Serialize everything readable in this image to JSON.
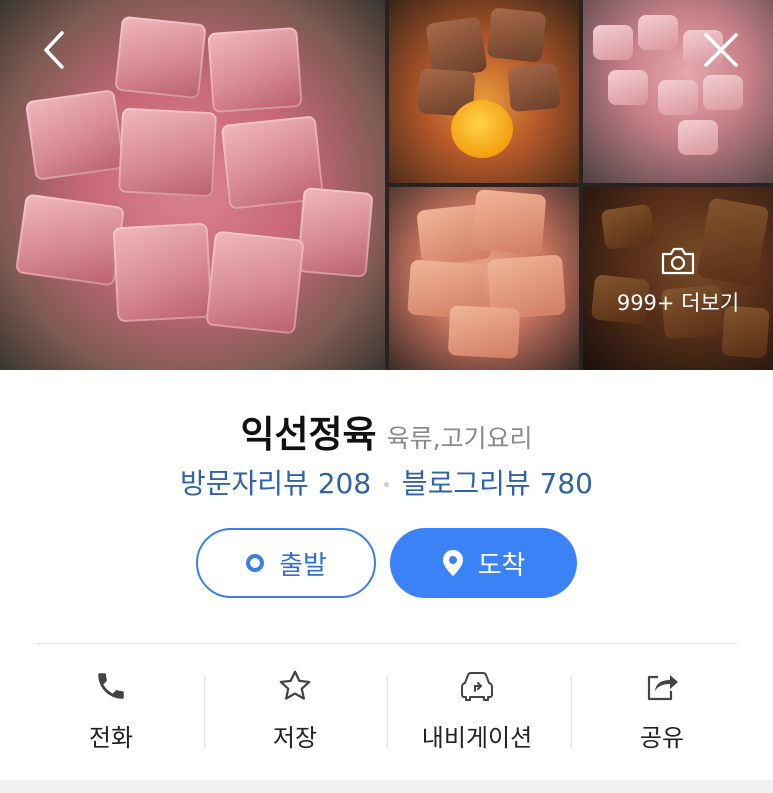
{
  "gallery": {
    "more_label": "999+ 더보기",
    "back_icon": "chevron-left-icon",
    "close_icon": "close-icon",
    "camera_icon": "camera-icon"
  },
  "place": {
    "name": "익선정육",
    "category": "육류,고기요리",
    "visitor_review": "방문자리뷰 208",
    "blog_review": "블로그리뷰 780"
  },
  "buttons": {
    "depart": "출발",
    "arrive": "도착"
  },
  "actions": [
    {
      "label": "전화",
      "icon": "phone-icon"
    },
    {
      "label": "저장",
      "icon": "star-icon"
    },
    {
      "label": "내비게이션",
      "icon": "car-navigation-icon"
    },
    {
      "label": "공유",
      "icon": "share-icon"
    }
  ],
  "colors": {
    "accent": "#3b82f6",
    "review_link": "#2f63a8"
  }
}
